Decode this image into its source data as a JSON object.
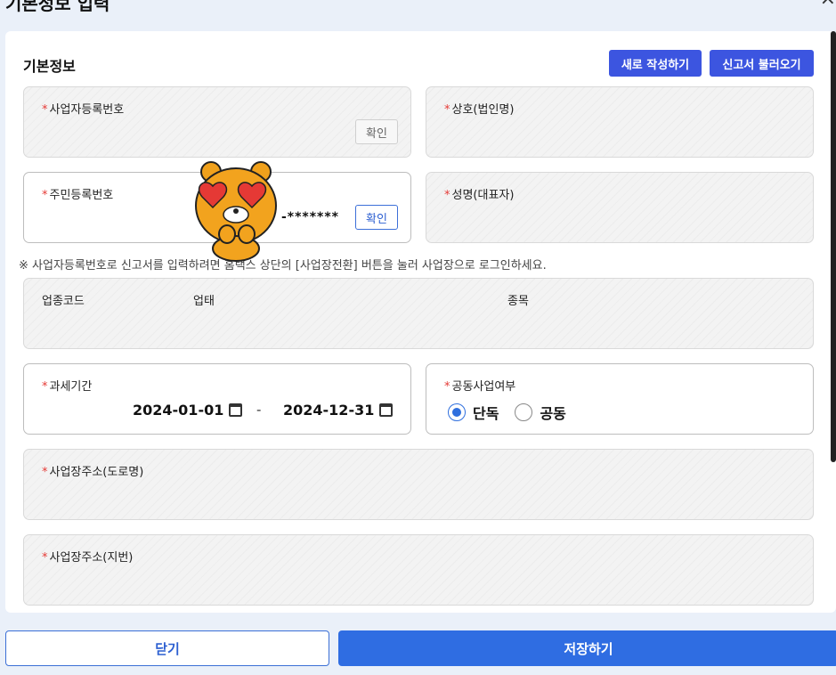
{
  "modal": {
    "title": "기본정보 입력",
    "close_icon": "close-icon"
  },
  "section": {
    "title": "기본정보",
    "new_button": "새로 작성하기",
    "load_button": "신고서 불러오기"
  },
  "fields": {
    "business_no": {
      "label": "사업자등록번호",
      "confirm": "확인"
    },
    "company_name": {
      "label": "상호(법인명)"
    },
    "resident_no": {
      "label": "주민등록번호",
      "masked": "-*******",
      "confirm": "확인"
    },
    "representative": {
      "label": "성명(대표자)"
    },
    "industry": {
      "code_label": "업종코드",
      "type_label": "업태",
      "item_label": "종목"
    },
    "tax_period": {
      "label": "과세기간",
      "start": "2024-01-01",
      "end": "2024-12-31",
      "separator": "-"
    },
    "joint_business": {
      "label": "공동사업여부",
      "options": [
        "단독",
        "공동"
      ],
      "selected": "단독"
    },
    "address_road": {
      "label": "사업장주소(도로명)"
    },
    "address_lot": {
      "label": "사업장주소(지번)"
    }
  },
  "notice": "※ 사업자등록번호로 신고서를 입력하려면 홈택스 상단의 [사업장전환] 버튼을 눌러 사업장으로 로그인하세요.",
  "footer": {
    "close": "닫기",
    "save": "저장하기"
  },
  "colors": {
    "primary": "#2f6de2",
    "accent": "#3c55e0",
    "required": "#e53935"
  }
}
